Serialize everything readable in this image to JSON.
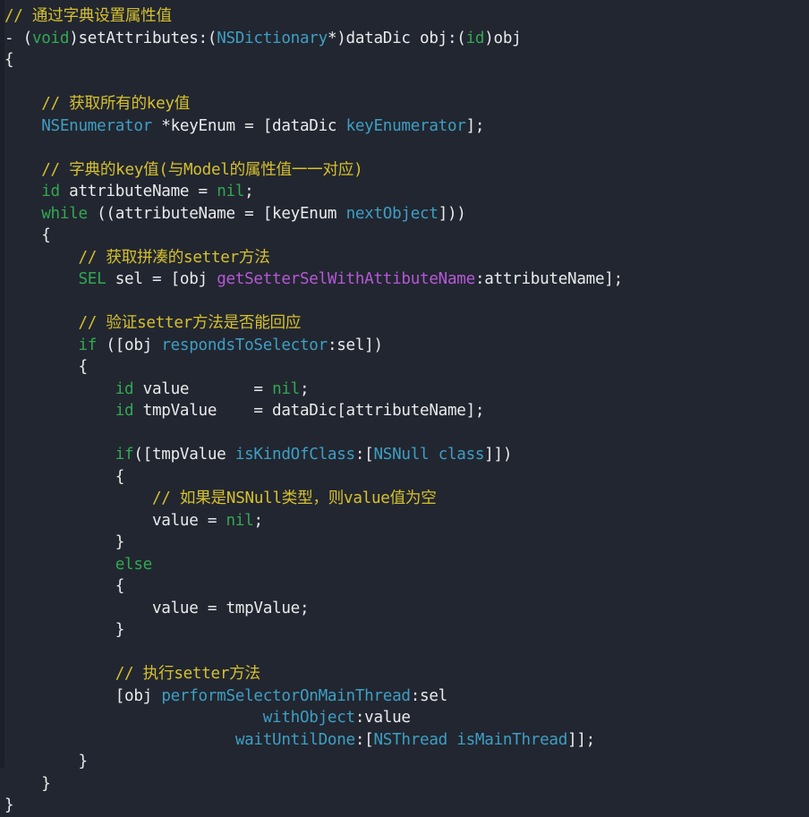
{
  "editor": {
    "language": "Objective-C",
    "background_color": "#222630",
    "gutter_color": "#1c1f27",
    "font_size_px": 17.6,
    "line_height_px": 24.5,
    "colors": {
      "plain": "#e9eaec",
      "comment": "#d5c02e",
      "keyword": "#32a852",
      "type": "#3d9fc4",
      "method": "#3d9fc4",
      "magenta": "#b558d8"
    }
  },
  "code": {
    "lines": [
      [
        {
          "t": "// 通过字典设置属性值",
          "c": "comment"
        }
      ],
      [
        {
          "t": "- ",
          "c": "plain"
        },
        {
          "t": "(",
          "c": "punct"
        },
        {
          "t": "void",
          "c": "keyword"
        },
        {
          "t": ")setAttributes:(",
          "c": "plain"
        },
        {
          "t": "NSDictionary",
          "c": "type"
        },
        {
          "t": "*)dataDic obj:(",
          "c": "plain"
        },
        {
          "t": "id",
          "c": "keyword"
        },
        {
          "t": ")obj",
          "c": "plain"
        }
      ],
      [
        {
          "t": "{",
          "c": "plain"
        }
      ],
      [
        {
          "t": "",
          "c": "plain"
        }
      ],
      [
        {
          "t": "    // 获取所有的key值",
          "c": "comment"
        }
      ],
      [
        {
          "t": "    ",
          "c": "plain"
        },
        {
          "t": "NSEnumerator",
          "c": "type"
        },
        {
          "t": " *keyEnum = [dataDic ",
          "c": "plain"
        },
        {
          "t": "keyEnumerator",
          "c": "method"
        },
        {
          "t": "];",
          "c": "plain"
        }
      ],
      [
        {
          "t": "",
          "c": "plain"
        }
      ],
      [
        {
          "t": "    // 字典的key值(与Model的属性值一一对应)",
          "c": "comment"
        }
      ],
      [
        {
          "t": "    ",
          "c": "plain"
        },
        {
          "t": "id",
          "c": "keyword"
        },
        {
          "t": " attributeName = ",
          "c": "plain"
        },
        {
          "t": "nil",
          "c": "keyword"
        },
        {
          "t": ";",
          "c": "plain"
        }
      ],
      [
        {
          "t": "    ",
          "c": "plain"
        },
        {
          "t": "while",
          "c": "keyword"
        },
        {
          "t": " ((attributeName = [keyEnum ",
          "c": "plain"
        },
        {
          "t": "nextObject",
          "c": "method"
        },
        {
          "t": "]))",
          "c": "plain"
        }
      ],
      [
        {
          "t": "    {",
          "c": "plain"
        }
      ],
      [
        {
          "t": "        // 获取拼凑的setter方法",
          "c": "comment"
        }
      ],
      [
        {
          "t": "        ",
          "c": "plain"
        },
        {
          "t": "SEL",
          "c": "keyword"
        },
        {
          "t": " sel = [obj ",
          "c": "plain"
        },
        {
          "t": "getSetterSelWithAttibuteName",
          "c": "magenta"
        },
        {
          "t": ":attributeName];",
          "c": "plain"
        }
      ],
      [
        {
          "t": "",
          "c": "plain"
        }
      ],
      [
        {
          "t": "        // 验证setter方法是否能回应",
          "c": "comment"
        }
      ],
      [
        {
          "t": "        ",
          "c": "plain"
        },
        {
          "t": "if",
          "c": "keyword"
        },
        {
          "t": " ([obj ",
          "c": "plain"
        },
        {
          "t": "respondsToSelector",
          "c": "method"
        },
        {
          "t": ":sel])",
          "c": "plain"
        }
      ],
      [
        {
          "t": "        {",
          "c": "plain"
        }
      ],
      [
        {
          "t": "            ",
          "c": "plain"
        },
        {
          "t": "id",
          "c": "keyword"
        },
        {
          "t": " value       = ",
          "c": "plain"
        },
        {
          "t": "nil",
          "c": "keyword"
        },
        {
          "t": ";",
          "c": "plain"
        }
      ],
      [
        {
          "t": "            ",
          "c": "plain"
        },
        {
          "t": "id",
          "c": "keyword"
        },
        {
          "t": " tmpValue    = dataDic[attributeName];",
          "c": "plain"
        }
      ],
      [
        {
          "t": "",
          "c": "plain"
        }
      ],
      [
        {
          "t": "            ",
          "c": "plain"
        },
        {
          "t": "if",
          "c": "keyword"
        },
        {
          "t": "([tmpValue ",
          "c": "plain"
        },
        {
          "t": "isKindOfClass",
          "c": "method"
        },
        {
          "t": ":[",
          "c": "plain"
        },
        {
          "t": "NSNull",
          "c": "type"
        },
        {
          "t": " ",
          "c": "plain"
        },
        {
          "t": "class",
          "c": "method"
        },
        {
          "t": "]])",
          "c": "plain"
        }
      ],
      [
        {
          "t": "            {",
          "c": "plain"
        }
      ],
      [
        {
          "t": "                // 如果是NSNull类型，则value值为空",
          "c": "comment"
        }
      ],
      [
        {
          "t": "                value = ",
          "c": "plain"
        },
        {
          "t": "nil",
          "c": "keyword"
        },
        {
          "t": ";",
          "c": "plain"
        }
      ],
      [
        {
          "t": "            }",
          "c": "plain"
        }
      ],
      [
        {
          "t": "            ",
          "c": "plain"
        },
        {
          "t": "else",
          "c": "keyword"
        }
      ],
      [
        {
          "t": "            {",
          "c": "plain"
        }
      ],
      [
        {
          "t": "                value = tmpValue;",
          "c": "plain"
        }
      ],
      [
        {
          "t": "            }",
          "c": "plain"
        }
      ],
      [
        {
          "t": "",
          "c": "plain"
        }
      ],
      [
        {
          "t": "            // 执行setter方法",
          "c": "comment"
        }
      ],
      [
        {
          "t": "            [obj ",
          "c": "plain"
        },
        {
          "t": "performSelectorOnMainThread",
          "c": "method"
        },
        {
          "t": ":sel",
          "c": "plain"
        }
      ],
      [
        {
          "t": "                            ",
          "c": "plain"
        },
        {
          "t": "withObject",
          "c": "method"
        },
        {
          "t": ":value",
          "c": "plain"
        }
      ],
      [
        {
          "t": "                         ",
          "c": "plain"
        },
        {
          "t": "waitUntilDone",
          "c": "method"
        },
        {
          "t": ":[",
          "c": "plain"
        },
        {
          "t": "NSThread",
          "c": "type"
        },
        {
          "t": " ",
          "c": "plain"
        },
        {
          "t": "isMainThread",
          "c": "method"
        },
        {
          "t": "]];",
          "c": "plain"
        }
      ],
      [
        {
          "t": "        }",
          "c": "plain"
        }
      ],
      [
        {
          "t": "    }",
          "c": "plain"
        }
      ],
      [
        {
          "t": "}",
          "c": "plain"
        }
      ]
    ]
  }
}
